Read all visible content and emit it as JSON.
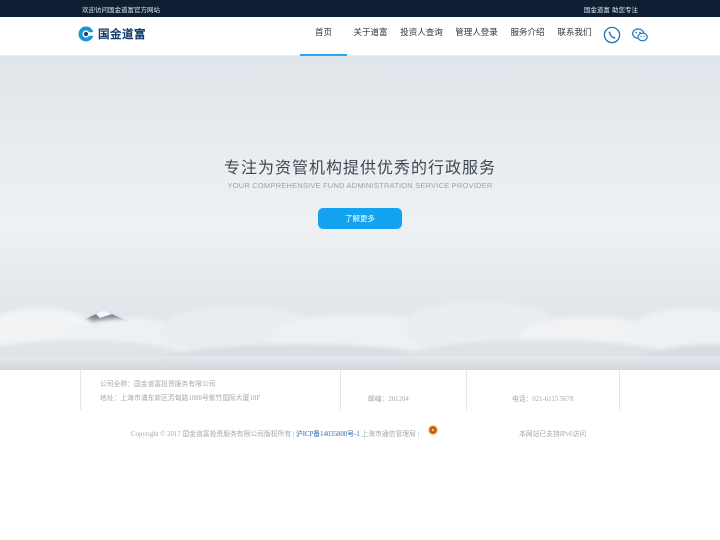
{
  "topbar": {
    "welcome": "欢迎访问国金道富官方网站",
    "slogan": "国金道富 助您专注"
  },
  "header": {
    "logo_text": "国金道富",
    "nav": [
      {
        "label": "首页",
        "active": true
      },
      {
        "label": "关于道富"
      },
      {
        "label": "投资人查询"
      },
      {
        "label": "管理人登录"
      },
      {
        "label": "服务介绍"
      },
      {
        "label": "联系我们"
      }
    ],
    "icons": [
      "phone-icon",
      "wechat-icon"
    ]
  },
  "hero": {
    "title": "专注为资管机构提供优秀的行政服务",
    "subtitle": "YOUR COMPREHENSIVE FUND ADMINISTRATION SERVICE PROVIDER",
    "button": "了解更多"
  },
  "info": {
    "company": "公司全称：国金道富投资服务有限公司",
    "address": "地址：上海市浦东新区芳甸路1088号紫竹国际大厦18F",
    "postcode": "邮编：201204",
    "phone": "电话：021-6115 5678"
  },
  "footer": {
    "copyright": "Copyright © 2017 国金道富投资服务有限公司版权所有 |",
    "icp": "沪ICP备14035800号-1",
    "regulator": " 上海市通信管理局 |",
    "ipv6": "本网站已支持IPv6访问"
  },
  "colors": {
    "topbar_bg": "#0e1e33",
    "accent": "#14a3f0",
    "nav_active_underline": "#2aa7ef"
  }
}
